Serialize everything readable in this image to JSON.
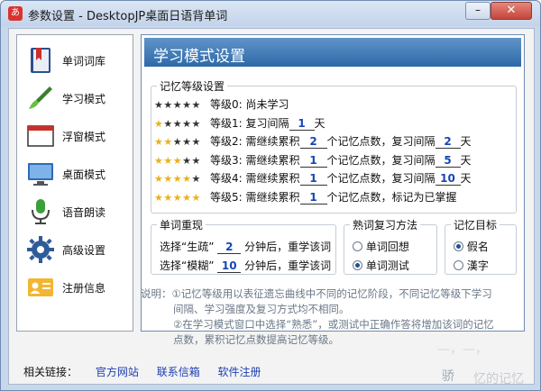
{
  "window": {
    "title": "参数设置 - DesktopJP桌面日语背单词",
    "app_icon_text": "あ",
    "minimize_glyph": "–",
    "close_glyph": "✕"
  },
  "sidebar": {
    "items": [
      {
        "label": "单词词库",
        "icon": "bookmark-book-icon"
      },
      {
        "label": "学习模式",
        "icon": "paintbrush-icon"
      },
      {
        "label": "浮窗模式",
        "icon": "window-icon"
      },
      {
        "label": "桌面模式",
        "icon": "monitor-icon"
      },
      {
        "label": "语音朗读",
        "icon": "microphone-icon"
      },
      {
        "label": "高级设置",
        "icon": "gear-icon"
      },
      {
        "label": "注册信息",
        "icon": "id-card-icon"
      }
    ]
  },
  "panel": {
    "title": "学习模式设置",
    "memory_levels": {
      "legend": "记忆等级设置",
      "rows": [
        {
          "stars": 0,
          "text1": "等级0:  尚未学习"
        },
        {
          "stars": 1,
          "text1": "等级1:  复习间隔",
          "v1": "1",
          "text2": "天"
        },
        {
          "stars": 2,
          "text1": "等级2:  需继续累积",
          "v1": "2",
          "text2": "个记忆点数，复习间隔",
          "v2": "2",
          "text3": "天"
        },
        {
          "stars": 3,
          "text1": "等级3:  需继续累积",
          "v1": "1",
          "text2": "个记忆点数，复习间隔",
          "v2": "5",
          "text3": "天"
        },
        {
          "stars": 4,
          "text1": "等级4:  需继续累积",
          "v1": "1",
          "text2": "个记忆点数，复习间隔",
          "v2": "10",
          "text3": "天"
        },
        {
          "stars": 5,
          "text1": "等级5:  需继续累积",
          "v1": "1",
          "text2": "个记忆点数，标记为已掌握"
        }
      ]
    },
    "reappear": {
      "legend": "单词重现",
      "row1": {
        "pre": "选择“生疏”",
        "value": "2",
        "post": "分钟后，重学该词"
      },
      "row2": {
        "pre": "选择“模糊”",
        "value": "10",
        "post": "分钟后，重学该词"
      }
    },
    "review_method": {
      "legend": "熟词复习方法",
      "options": [
        {
          "label": "单词回想",
          "selected": false
        },
        {
          "label": "单词测试",
          "selected": true
        }
      ]
    },
    "memory_target": {
      "legend": "记忆目标",
      "options": [
        {
          "label": "假名",
          "selected": true
        },
        {
          "label": "漢字",
          "selected": false
        }
      ]
    }
  },
  "note": {
    "line1": "说明：①记忆等级用以表征遗忘曲线中不同的记忆阶段，不同记忆等级下学习",
    "line2": "间隔、学习强度及复习方式均不相同。",
    "line3": "②在学习模式窗口中选择“熟悉”，或测试中正确作答将增加该词的记忆",
    "line4": "点数，累积记忆点数提高记忆等级。"
  },
  "footer": {
    "label": "相关链接：",
    "links": [
      "官方网站",
      "联系信箱",
      "软件注册"
    ]
  },
  "watermark": {
    "text1": "—，—，",
    "text2": "骄",
    "text3": "忆的记忆"
  },
  "colors": {
    "header_blue": "#2e6aa9",
    "star_gold": "#e8b11e",
    "value_blue": "#1746b4",
    "link_blue": "#1c3fb0"
  }
}
